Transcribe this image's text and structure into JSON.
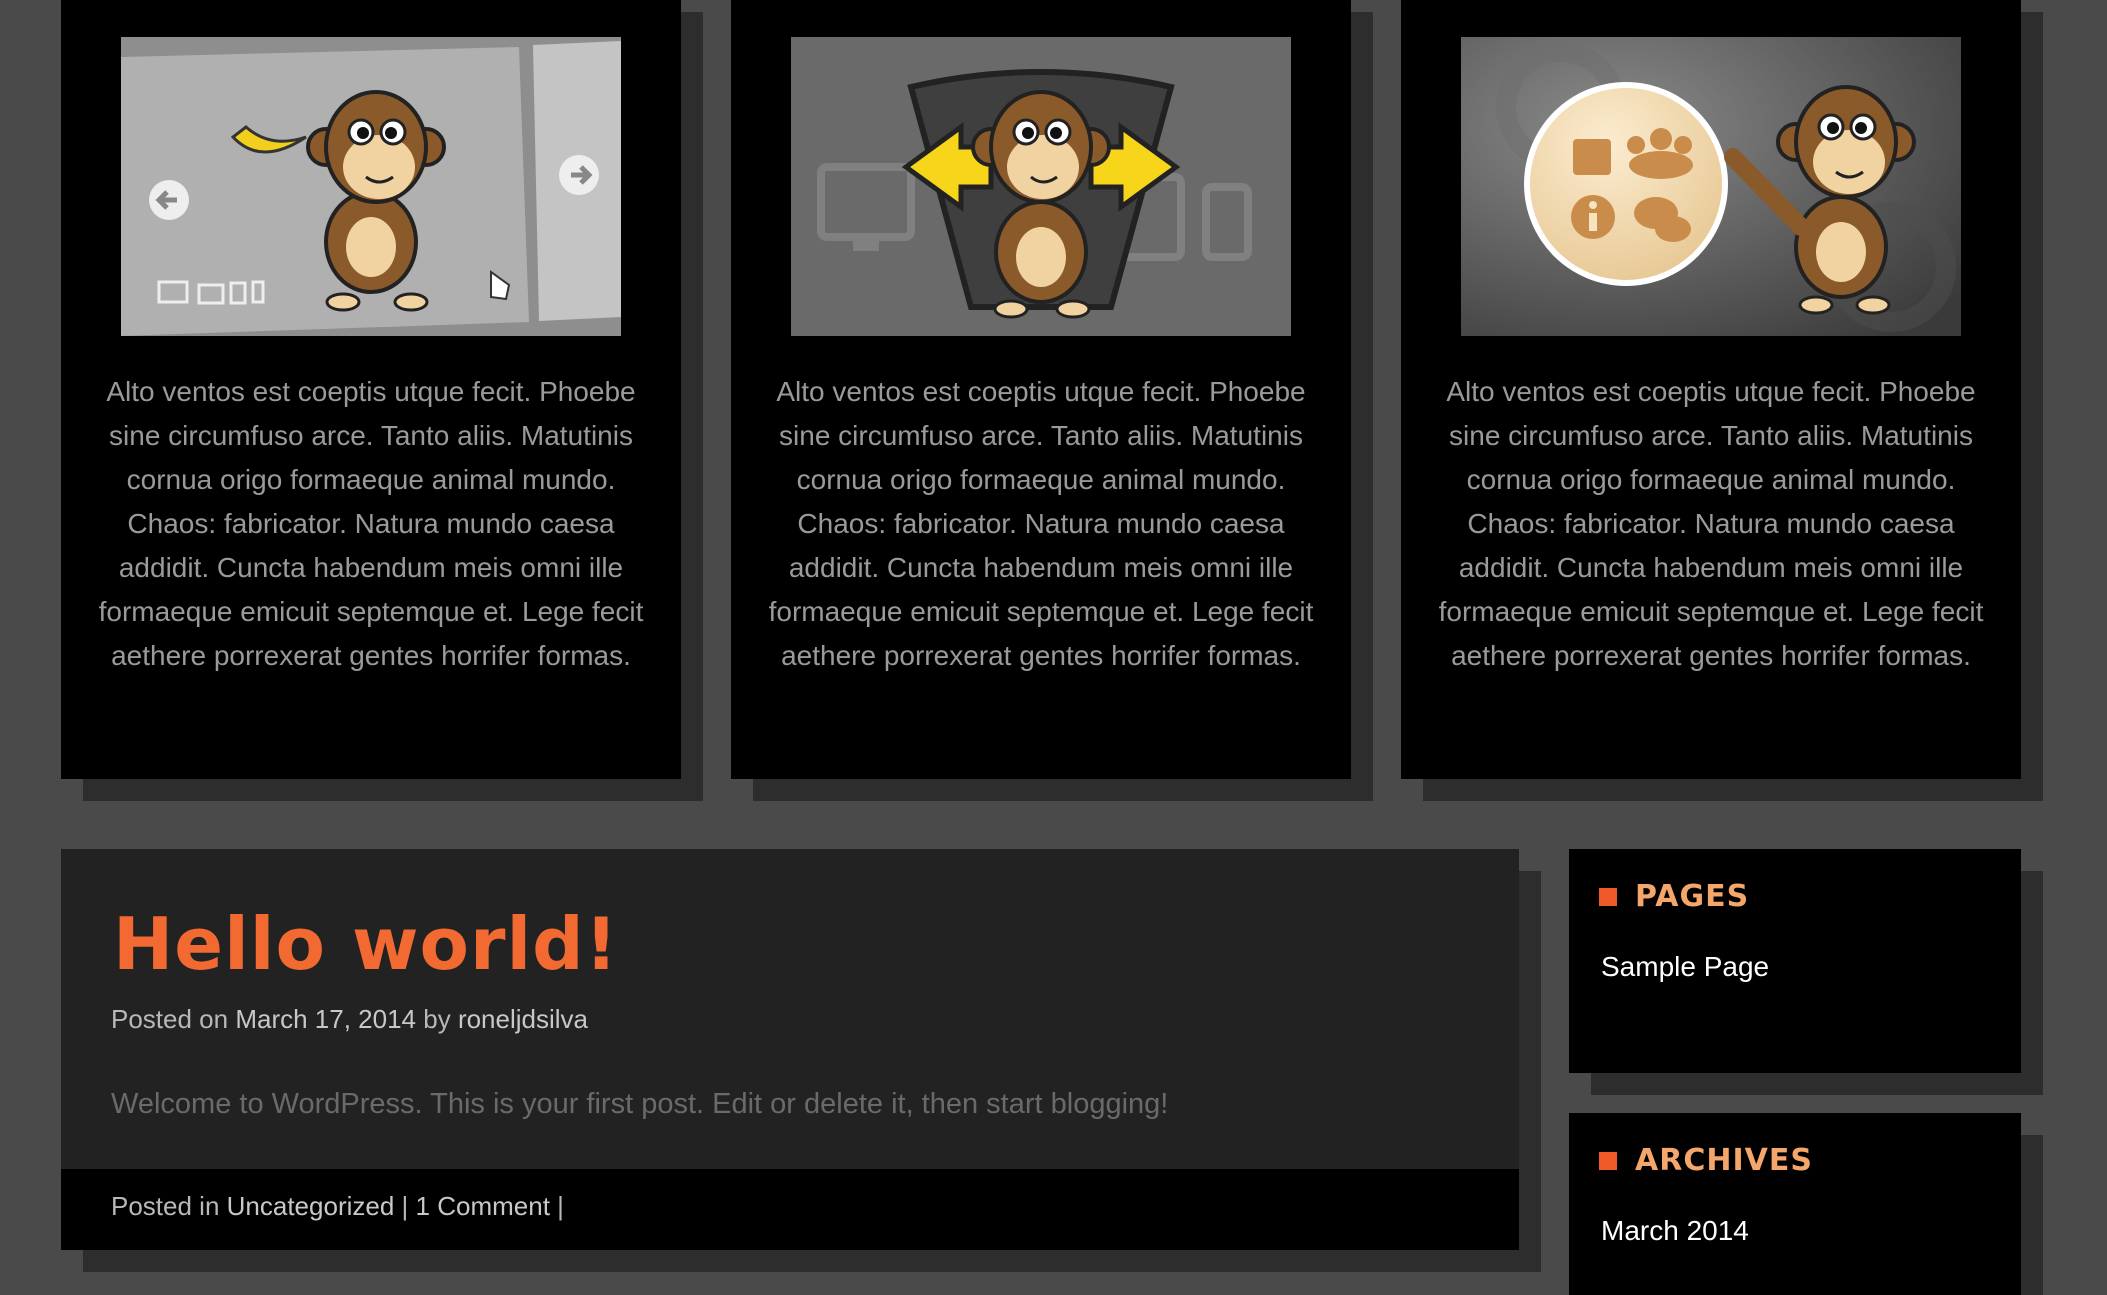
{
  "features": [
    {
      "icon": "monkey-slider-illustration",
      "text": "Alto ventos est coeptis utque fecit. Phoebe sine circumfuso arce. Tanto aliis. Matutinis cornua origo formaeque animal mundo. Chaos: fabricator. Natura mundo caesa addidit. Cuncta habendum meis omni ille formaeque emicuit septemque et. Lege fecit aethere porrexerat gentes horrifer formas."
    },
    {
      "icon": "monkey-responsive-illustration",
      "text": "Alto ventos est coeptis utque fecit. Phoebe sine circumfuso arce. Tanto aliis. Matutinis cornua origo formaeque animal mundo. Chaos: fabricator. Natura mundo caesa addidit. Cuncta habendum meis omni ille formaeque emicuit septemque et. Lege fecit aethere porrexerat gentes horrifer formas."
    },
    {
      "icon": "monkey-widgets-illustration",
      "text": "Alto ventos est coeptis utque fecit. Phoebe sine circumfuso arce. Tanto aliis. Matutinis cornua origo formaeque animal mundo. Chaos: fabricator. Natura mundo caesa addidit. Cuncta habendum meis omni ille formaeque emicuit septemque et. Lege fecit aethere porrexerat gentes horrifer formas."
    }
  ],
  "post": {
    "title": "Hello world!",
    "meta": {
      "posted_on": "Posted on",
      "date": "March 17, 2014",
      "by": "by",
      "author": "roneljdsilva"
    },
    "body": "Welcome to WordPress. This is your first post. Edit or delete it, then start blogging!",
    "footer": {
      "posted_in": "Posted in",
      "category": "Uncategorized",
      "sep1": "|",
      "comments": "1 Comment",
      "sep2": "|"
    }
  },
  "widgets": {
    "pages": {
      "title": "PAGES",
      "items": [
        "Sample Page"
      ]
    },
    "archives": {
      "title": "ARCHIVES",
      "items": [
        "March 2014"
      ]
    }
  },
  "colors": {
    "accent": "#f26a32",
    "widget_title": "#f5a66a",
    "background": "#4a4a4a"
  }
}
